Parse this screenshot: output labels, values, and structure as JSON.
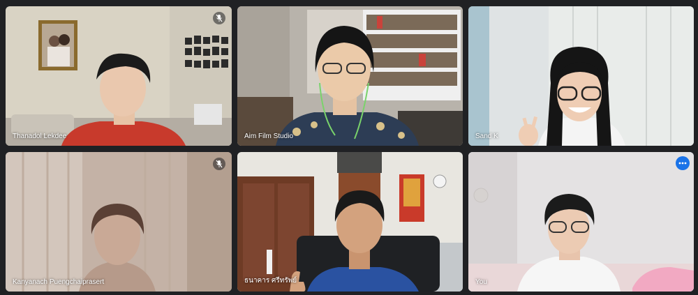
{
  "meeting": {
    "tiles": [
      {
        "name": "Thanadol Lekdee",
        "muted": true
      },
      {
        "name": "Aim Film Studio",
        "muted": false
      },
      {
        "name": "Sand K",
        "muted": false
      },
      {
        "name": "Kanyanach Puengchaiprasert",
        "muted": true
      },
      {
        "name": "ธนาคาร ศรีทรัพย์",
        "muted": false
      },
      {
        "name": "You",
        "muted": false,
        "self": true
      }
    ]
  },
  "icons": {
    "muted": "mic-off-icon",
    "options": "more-options-icon"
  },
  "colors": {
    "background": "#202124",
    "active_outline": "#8ab4f8",
    "options_button": "#1a73e8"
  }
}
